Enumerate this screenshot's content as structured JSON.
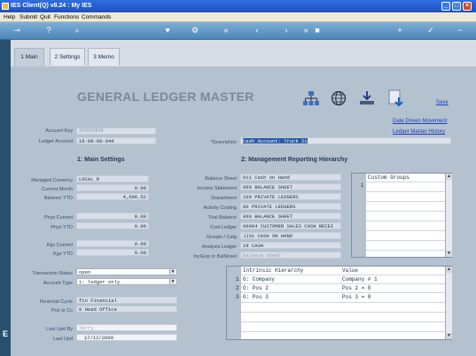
{
  "window": {
    "title": "IES Client(Q) v8.24 : My IES"
  },
  "menu": [
    "Help",
    "Submit",
    "Quit",
    "Functions",
    "Commands"
  ],
  "toolbar": {
    "icons": [
      "key-icon",
      "help-icon",
      "search-icon",
      "heart-icon",
      "settings-icon",
      "rewind-icon",
      "prev-icon",
      "next-icon",
      "fast-forward-icon",
      "stop-icon",
      "add-icon",
      "check-icon",
      "minus-icon"
    ]
  },
  "tabs": [
    {
      "label": "1 Main"
    },
    {
      "label": "2 Settings"
    },
    {
      "label": "3 Memo"
    }
  ],
  "heading": "GENERAL LEDGER MASTER",
  "actions": {
    "save": "Save",
    "date_driven": "Date Driven Movement",
    "history": "Ledger Master History"
  },
  "top": {
    "account_key_label": "Account Key",
    "account_key_value": "100000848",
    "ledger_account_label": "Ledger Account",
    "ledger_account_value": "18-88-88-84d",
    "description_label": "*Description",
    "description_value": "Cash Account: Truck 21"
  },
  "main_settings": {
    "title": "1: Main Settings",
    "managed_currency_label": "Managed Currency",
    "managed_currency_value": "LOCAL R",
    "current_month_label": "Current Month",
    "current_month_value": "0.00",
    "balance_ytd_label": "Balance YTD",
    "balance_ytd_value": "4,696.52",
    "phys_current_label": "Phys Current",
    "phys_current_value": "0.00",
    "phys_ytd_label": "Phys YTD",
    "phys_ytd_value": "0.00",
    "kgs_current_label": "Kgs Current",
    "kgs_current_value": "0.00",
    "kgs_ytd_label": "Kgs YTD",
    "kgs_ytd_value": "0.00",
    "transaction_status_label": "Transaction Status",
    "transaction_status_value": "open",
    "account_type_label": "Account Type",
    "account_type_value": "1: ledger only",
    "financial_cycle_label": "Financial Cycle",
    "financial_cycle_value": "fin Financial",
    "prsi_label": "Prsi or Cc",
    "prsi_value": "0 Head Office",
    "last_upd_by_label": "Last Upd By",
    "last_upd_by_value": "Terry",
    "last_upd_label": "Last Upd",
    "last_upd_value": "17/12/2009"
  },
  "hierarchy": {
    "title": "2: Management Reporting Hierarchy",
    "rows": [
      {
        "label": "Balance Sheet",
        "value": "011 Cash on Hand"
      },
      {
        "label": "Income Statement",
        "value": "000 BALANCE SHEET"
      },
      {
        "label": "Department",
        "value": "100 PRIVATE LEDGERS"
      },
      {
        "label": "Activity Costing",
        "value": "00 PRIVATE LEDGERS"
      },
      {
        "label": "Trial Balance",
        "value": "009 BALANCE SHEET"
      },
      {
        "label": "Cost Ledger",
        "value": "00084 CUSTOMER SALES CASH RECEI"
      },
      {
        "label": "Groups / Catg",
        "value": "JJ31 CASH ON HAND"
      },
      {
        "label": "Analysis Ledger",
        "value": "19 CASH"
      },
      {
        "label": "Inc/Exp or BalSheet",
        "value": "balance sheet"
      }
    ]
  },
  "custom_groups": {
    "header": "Custom Groups",
    "rows": [
      {
        "num": "1",
        "value": ""
      }
    ]
  },
  "intrinsic": {
    "col1": "Intrinsic Hierarchy",
    "col2": "Value",
    "rows": [
      {
        "num": "1",
        "name": "G: Company",
        "value": "Company # 1"
      },
      {
        "num": "2",
        "name": "G: Pos 2",
        "value": "Pos 2 = 0"
      },
      {
        "num": "3",
        "name": "G: Pos 3",
        "value": "Pos 3 = 0"
      }
    ]
  }
}
